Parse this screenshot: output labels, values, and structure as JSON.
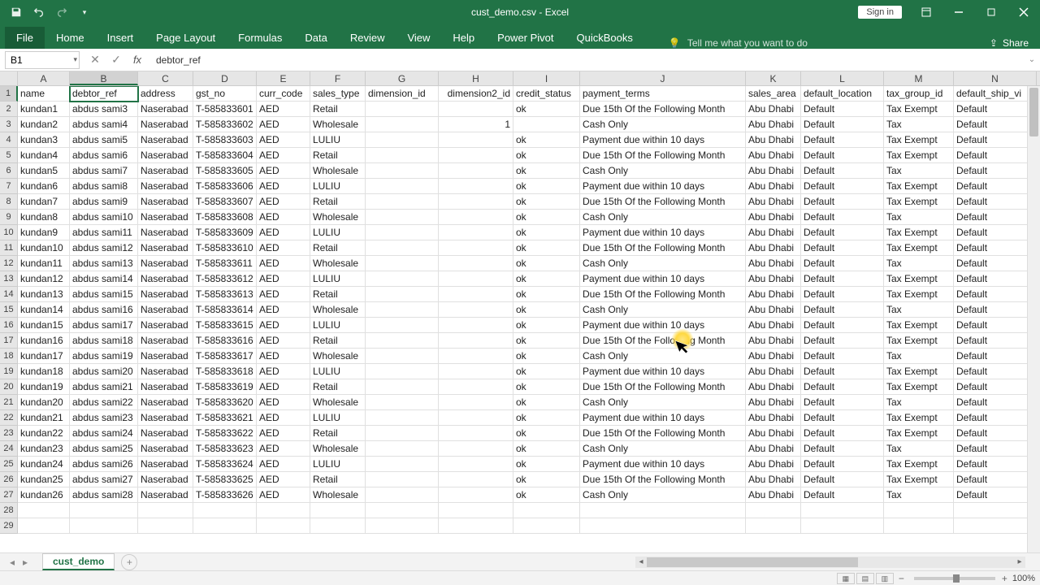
{
  "title_bar": {
    "filename": "cust_demo.csv",
    "app": "Excel",
    "signin": "Sign in"
  },
  "qat_icons": [
    "save-icon",
    "undo-icon",
    "redo-icon",
    "customize-icon"
  ],
  "ribbon": {
    "tabs": [
      "File",
      "Home",
      "Insert",
      "Page Layout",
      "Formulas",
      "Data",
      "Review",
      "View",
      "Help",
      "Power Pivot",
      "QuickBooks"
    ],
    "tell_me": "Tell me what you want to do",
    "share": "Share"
  },
  "formula_bar": {
    "name_box": "B1",
    "formula": "debtor_ref"
  },
  "columns": [
    "A",
    "B",
    "C",
    "D",
    "E",
    "F",
    "G",
    "H",
    "I",
    "J",
    "K",
    "L",
    "M",
    "N"
  ],
  "col_classes": [
    "cA",
    "cB",
    "cC",
    "cD",
    "cE",
    "cF",
    "cG",
    "cH",
    "cI",
    "cJ",
    "cK",
    "cL",
    "cM",
    "cN"
  ],
  "selected_col_idx": 1,
  "selected_row": 1,
  "headers": [
    "name",
    "debtor_ref",
    "address",
    "gst_no",
    "curr_code",
    "sales_type",
    "dimension_id",
    "dimension2_id",
    "credit_status",
    "payment_terms",
    "sales_area",
    "default_location",
    "tax_group_id",
    "default_ship_vi"
  ],
  "rows": [
    [
      "kundan1",
      "abdus sami3",
      "Naserabad",
      "T-585833601",
      "AED",
      "Retail",
      "",
      "",
      "ok",
      "Due 15th Of the Following Month",
      "Abu Dhabi",
      "Default",
      "Tax Exempt",
      "Default"
    ],
    [
      "kundan2",
      "abdus sami4",
      "Naserabad",
      "T-585833602",
      "AED",
      "Wholesale",
      "",
      "1",
      "",
      "Cash Only",
      "Abu Dhabi",
      "Default",
      "Tax",
      "Default"
    ],
    [
      "kundan3",
      "abdus sami5",
      "Naserabad",
      "T-585833603",
      "AED",
      "LULIU",
      "",
      "",
      "ok",
      "Payment due within 10 days",
      "Abu Dhabi",
      "Default",
      "Tax Exempt",
      "Default"
    ],
    [
      "kundan4",
      "abdus sami6",
      "Naserabad",
      "T-585833604",
      "AED",
      "Retail",
      "",
      "",
      "ok",
      "Due 15th Of the Following Month",
      "Abu Dhabi",
      "Default",
      "Tax Exempt",
      "Default"
    ],
    [
      "kundan5",
      "abdus sami7",
      "Naserabad",
      "T-585833605",
      "AED",
      "Wholesale",
      "",
      "",
      "ok",
      "Cash Only",
      "Abu Dhabi",
      "Default",
      "Tax",
      "Default"
    ],
    [
      "kundan6",
      "abdus sami8",
      "Naserabad",
      "T-585833606",
      "AED",
      "LULIU",
      "",
      "",
      "ok",
      "Payment due within 10 days",
      "Abu Dhabi",
      "Default",
      "Tax Exempt",
      "Default"
    ],
    [
      "kundan7",
      "abdus sami9",
      "Naserabad",
      "T-585833607",
      "AED",
      "Retail",
      "",
      "",
      "ok",
      "Due 15th Of the Following Month",
      "Abu Dhabi",
      "Default",
      "Tax Exempt",
      "Default"
    ],
    [
      "kundan8",
      "abdus sami10",
      "Naserabad",
      "T-585833608",
      "AED",
      "Wholesale",
      "",
      "",
      "ok",
      "Cash Only",
      "Abu Dhabi",
      "Default",
      "Tax",
      "Default"
    ],
    [
      "kundan9",
      "abdus sami11",
      "Naserabad",
      "T-585833609",
      "AED",
      "LULIU",
      "",
      "",
      "ok",
      "Payment due within 10 days",
      "Abu Dhabi",
      "Default",
      "Tax Exempt",
      "Default"
    ],
    [
      "kundan10",
      "abdus sami12",
      "Naserabad",
      "T-585833610",
      "AED",
      "Retail",
      "",
      "",
      "ok",
      "Due 15th Of the Following Month",
      "Abu Dhabi",
      "Default",
      "Tax Exempt",
      "Default"
    ],
    [
      "kundan11",
      "abdus sami13",
      "Naserabad",
      "T-585833611",
      "AED",
      "Wholesale",
      "",
      "",
      "ok",
      "Cash Only",
      "Abu Dhabi",
      "Default",
      "Tax",
      "Default"
    ],
    [
      "kundan12",
      "abdus sami14",
      "Naserabad",
      "T-585833612",
      "AED",
      "LULIU",
      "",
      "",
      "ok",
      "Payment due within 10 days",
      "Abu Dhabi",
      "Default",
      "Tax Exempt",
      "Default"
    ],
    [
      "kundan13",
      "abdus sami15",
      "Naserabad",
      "T-585833613",
      "AED",
      "Retail",
      "",
      "",
      "ok",
      "Due 15th Of the Following Month",
      "Abu Dhabi",
      "Default",
      "Tax Exempt",
      "Default"
    ],
    [
      "kundan14",
      "abdus sami16",
      "Naserabad",
      "T-585833614",
      "AED",
      "Wholesale",
      "",
      "",
      "ok",
      "Cash Only",
      "Abu Dhabi",
      "Default",
      "Tax",
      "Default"
    ],
    [
      "kundan15",
      "abdus sami17",
      "Naserabad",
      "T-585833615",
      "AED",
      "LULIU",
      "",
      "",
      "ok",
      "Payment due within 10 days",
      "Abu Dhabi",
      "Default",
      "Tax Exempt",
      "Default"
    ],
    [
      "kundan16",
      "abdus sami18",
      "Naserabad",
      "T-585833616",
      "AED",
      "Retail",
      "",
      "",
      "ok",
      "Due 15th Of the Following Month",
      "Abu Dhabi",
      "Default",
      "Tax Exempt",
      "Default"
    ],
    [
      "kundan17",
      "abdus sami19",
      "Naserabad",
      "T-585833617",
      "AED",
      "Wholesale",
      "",
      "",
      "ok",
      "Cash Only",
      "Abu Dhabi",
      "Default",
      "Tax",
      "Default"
    ],
    [
      "kundan18",
      "abdus sami20",
      "Naserabad",
      "T-585833618",
      "AED",
      "LULIU",
      "",
      "",
      "ok",
      "Payment due within 10 days",
      "Abu Dhabi",
      "Default",
      "Tax Exempt",
      "Default"
    ],
    [
      "kundan19",
      "abdus sami21",
      "Naserabad",
      "T-585833619",
      "AED",
      "Retail",
      "",
      "",
      "ok",
      "Due 15th Of the Following Month",
      "Abu Dhabi",
      "Default",
      "Tax Exempt",
      "Default"
    ],
    [
      "kundan20",
      "abdus sami22",
      "Naserabad",
      "T-585833620",
      "AED",
      "Wholesale",
      "",
      "",
      "ok",
      "Cash Only",
      "Abu Dhabi",
      "Default",
      "Tax",
      "Default"
    ],
    [
      "kundan21",
      "abdus sami23",
      "Naserabad",
      "T-585833621",
      "AED",
      "LULIU",
      "",
      "",
      "ok",
      "Payment due within 10 days",
      "Abu Dhabi",
      "Default",
      "Tax Exempt",
      "Default"
    ],
    [
      "kundan22",
      "abdus sami24",
      "Naserabad",
      "T-585833622",
      "AED",
      "Retail",
      "",
      "",
      "ok",
      "Due 15th Of the Following Month",
      "Abu Dhabi",
      "Default",
      "Tax Exempt",
      "Default"
    ],
    [
      "kundan23",
      "abdus sami25",
      "Naserabad",
      "T-585833623",
      "AED",
      "Wholesale",
      "",
      "",
      "ok",
      "Cash Only",
      "Abu Dhabi",
      "Default",
      "Tax",
      "Default"
    ],
    [
      "kundan24",
      "abdus sami26",
      "Naserabad",
      "T-585833624",
      "AED",
      "LULIU",
      "",
      "",
      "ok",
      "Payment due within 10 days",
      "Abu Dhabi",
      "Default",
      "Tax Exempt",
      "Default"
    ],
    [
      "kundan25",
      "abdus sami27",
      "Naserabad",
      "T-585833625",
      "AED",
      "Retail",
      "",
      "",
      "ok",
      "Due 15th Of the Following Month",
      "Abu Dhabi",
      "Default",
      "Tax Exempt",
      "Default"
    ],
    [
      "kundan26",
      "abdus sami28",
      "Naserabad",
      "T-585833626",
      "AED",
      "Wholesale",
      "",
      "",
      "ok",
      "Cash Only",
      "Abu Dhabi",
      "Default",
      "Tax",
      "Default"
    ]
  ],
  "empty_rows": [
    28,
    29
  ],
  "sheet": {
    "name": "cust_demo"
  },
  "status": {
    "zoom": "100%"
  },
  "numeric_cols": [
    7
  ]
}
